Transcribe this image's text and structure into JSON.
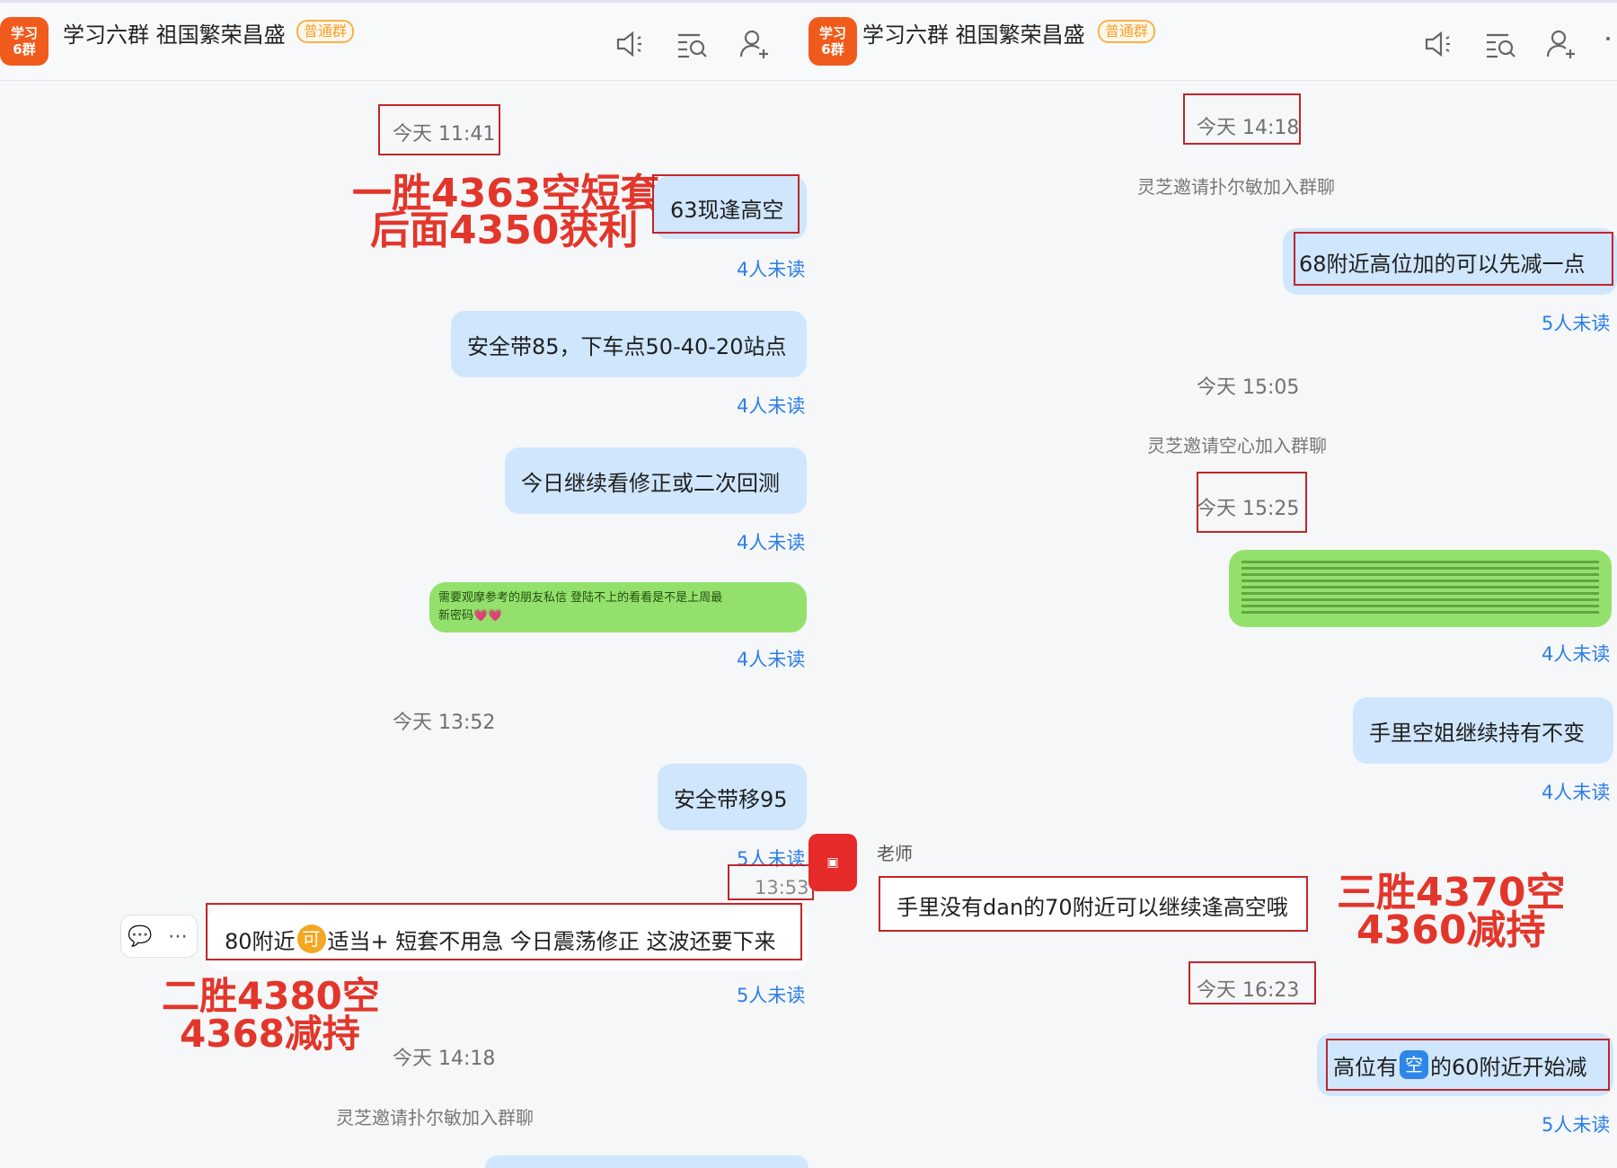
{
  "colors": {
    "bubble_blue": "#cfe6fc",
    "bubble_green": "#93e16c",
    "unread_blue": "#2c7ee8",
    "annotation_red": "#e3362b",
    "box_red": "#c0262b",
    "avatar_orange": "#f05a1a",
    "tag_orange": "#f7a12a"
  },
  "left": {
    "header": {
      "avatar_line1": "学习",
      "avatar_line2": "6群",
      "title": "学习六群 祖国繁荣昌盛",
      "tag": "普通群",
      "icons": [
        "speaker-muted-icon",
        "search-list-icon",
        "add-user-icon"
      ]
    },
    "ts1": "今天 11:41",
    "msg1": "63现逢高空",
    "unread1": "4人未读",
    "anno1_line1": "一胜4363空短套",
    "anno1_line2": "后面4350获利",
    "msg2": "安全带85，下车点50-40-20站点",
    "unread2": "4人未读",
    "msg3": "今日继续看修正或二次回测",
    "unread3": "4人未读",
    "msg4_line1": "需要观摩参考的朋友私信 登陆不上的看看是不是上周最",
    "msg4_line2": "新密码",
    "msg4_emoji": "💗💗",
    "unread4": "4人未读",
    "ts2": "今天 13:52",
    "msg5": "安全带移95",
    "unread5": "5人未读",
    "ts3": "13:53",
    "msg6_before": "80附近",
    "msg6_badge": "可",
    "msg6_after": "适当+ 短套不用急 今日震荡修正 这波还要下来",
    "unread6": "5人未读",
    "anno2_line1": "二胜4380空",
    "anno2_line2": "4368减持",
    "ts4": "今天 14:18",
    "sys1": "灵芝邀请扑尔敏加入群聊"
  },
  "right": {
    "header": {
      "avatar_line1": "学习",
      "avatar_line2": "6群",
      "title": "学习六群 祖国繁荣昌盛",
      "tag": "普通群",
      "icons": [
        "speaker-muted-icon",
        "search-list-icon",
        "add-user-icon"
      ]
    },
    "ts1": "今天 14:18",
    "sys1": "灵芝邀请扑尔敏加入群聊",
    "msg1": "68附近高位加的可以先减一点",
    "unread1": "5人未读",
    "ts2": "今天 15:05",
    "sys2": "灵芝邀请空心加入群聊",
    "ts3": "今天 15:25",
    "unread2": "4人未读",
    "msg3": "手里空姐继续持有不变",
    "unread3": "4人未读",
    "sender": "老师",
    "msg4": "手里没有dan的70附近可以继续逢高空哦",
    "anno_line1": "三胜4370空",
    "anno_line2": "4360减持",
    "ts4": "今天 16:23",
    "msg5_before": "高位有",
    "msg5_badge": "空",
    "msg5_after": "的60附近开始减",
    "unread4": "5人未读"
  }
}
